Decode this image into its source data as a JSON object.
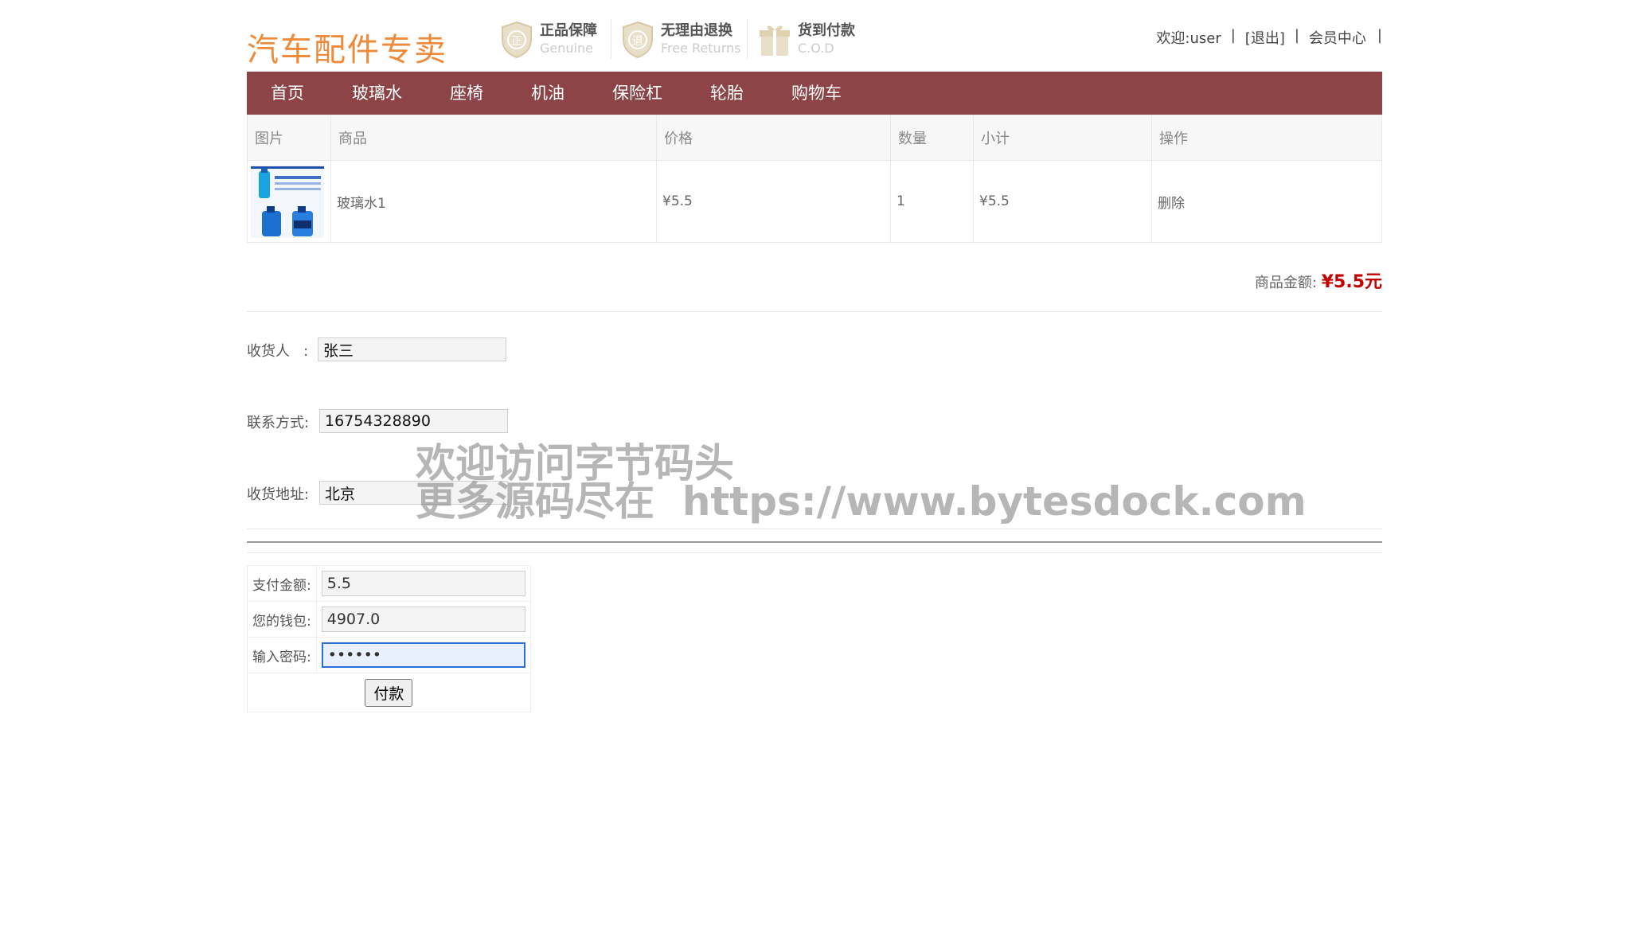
{
  "header": {
    "logo": "汽车配件专卖",
    "badges": [
      {
        "title": "正品保障",
        "sub": "Genuine",
        "icon": "正"
      },
      {
        "title": "无理由退换",
        "sub": "Free Returns",
        "icon": "退"
      },
      {
        "title": "货到付款",
        "sub": "C.O.D",
        "icon": "gift-icon"
      }
    ],
    "user": {
      "welcome": "欢迎:user",
      "sep": "|",
      "logout": "[退出]",
      "member": "会员中心"
    }
  },
  "nav": [
    "首页",
    "玻璃水",
    "座椅",
    "机油",
    "保险杠",
    "轮胎",
    "购物车"
  ],
  "cart": {
    "columns": [
      "图片",
      "商品",
      "价格",
      "数量",
      "小计",
      "操作"
    ],
    "rows": [
      {
        "name": "玻璃水1",
        "price": "¥5.5",
        "qty": "1",
        "subtotal": "¥5.5",
        "action": "删除"
      }
    ],
    "total_label": "商品金额:",
    "total_value": "¥5.5元"
  },
  "form": {
    "receiver_label": "收货人   :",
    "receiver_value": "张三",
    "contact_label": "联系方式:",
    "contact_value": "16754328890",
    "address_label": "收货地址:",
    "address_value": "北京"
  },
  "payment": {
    "amount_label": "支付金额:",
    "amount_value": "5.5",
    "wallet_label": "您的钱包:",
    "wallet_value": "4907.0",
    "password_label": "输入密码:",
    "password_value": "••••••",
    "pay_button": "付款"
  },
  "watermark": {
    "line1": "欢迎访问字节码头",
    "line2": "更多源码尽在  https://www.bytesdock.com"
  },
  "colors": {
    "nav_bg": "#8c4446",
    "logo": "#ee8a3a",
    "price": "#c40000"
  }
}
